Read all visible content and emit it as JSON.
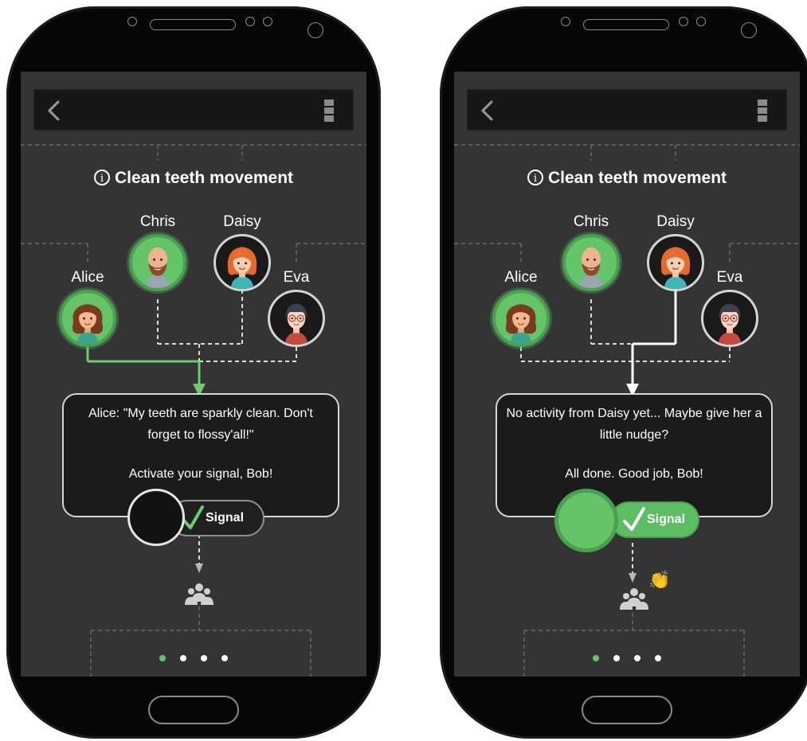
{
  "colors": {
    "screen_bg": "#343434",
    "accent_green": "#63c468",
    "phone_body": "#060606",
    "connector_dashed": "#dcdcdc",
    "connector_active_green": "#6ccc71",
    "connector_active_white": "#ffffff"
  },
  "icons": {
    "back": "chevron-left-icon",
    "menu": "overflow-menu-icon",
    "info": "info-icon",
    "check": "checkmark-icon",
    "group": "group-icon",
    "clap": "clapping-hands-emoji"
  },
  "screens": [
    {
      "state": "before-signal",
      "header": {
        "title": "Clean teeth movement",
        "info_glyph": "i"
      },
      "members": {
        "alice": {
          "name": "Alice",
          "status": "active"
        },
        "chris": {
          "name": "Chris",
          "status": "active"
        },
        "daisy": {
          "name": "Daisy",
          "status": "idle"
        },
        "eva": {
          "name": "Eva",
          "status": "idle"
        }
      },
      "highlighted_member": "Alice",
      "message": {
        "line1": "Alice: \"My teeth are sparkly clean. Don't forget to flossy'all!\"",
        "line2": "Activate your signal, Bob!"
      },
      "signal": {
        "label": "Signal",
        "state": "inactive"
      },
      "group_reaction": "",
      "pager": {
        "total": 4,
        "current": 1
      }
    },
    {
      "state": "after-signal",
      "header": {
        "title": "Clean teeth movement",
        "info_glyph": "i"
      },
      "members": {
        "alice": {
          "name": "Alice",
          "status": "active"
        },
        "chris": {
          "name": "Chris",
          "status": "active"
        },
        "daisy": {
          "name": "Daisy",
          "status": "idle"
        },
        "eva": {
          "name": "Eva",
          "status": "idle"
        }
      },
      "highlighted_member": "Daisy",
      "message": {
        "line1": "No activity from Daisy yet... Maybe give her a little nudge?",
        "line2": "All done. Good job, Bob!"
      },
      "signal": {
        "label": "Signal",
        "state": "active"
      },
      "group_reaction": "👏",
      "pager": {
        "total": 4,
        "current": 1
      }
    }
  ]
}
